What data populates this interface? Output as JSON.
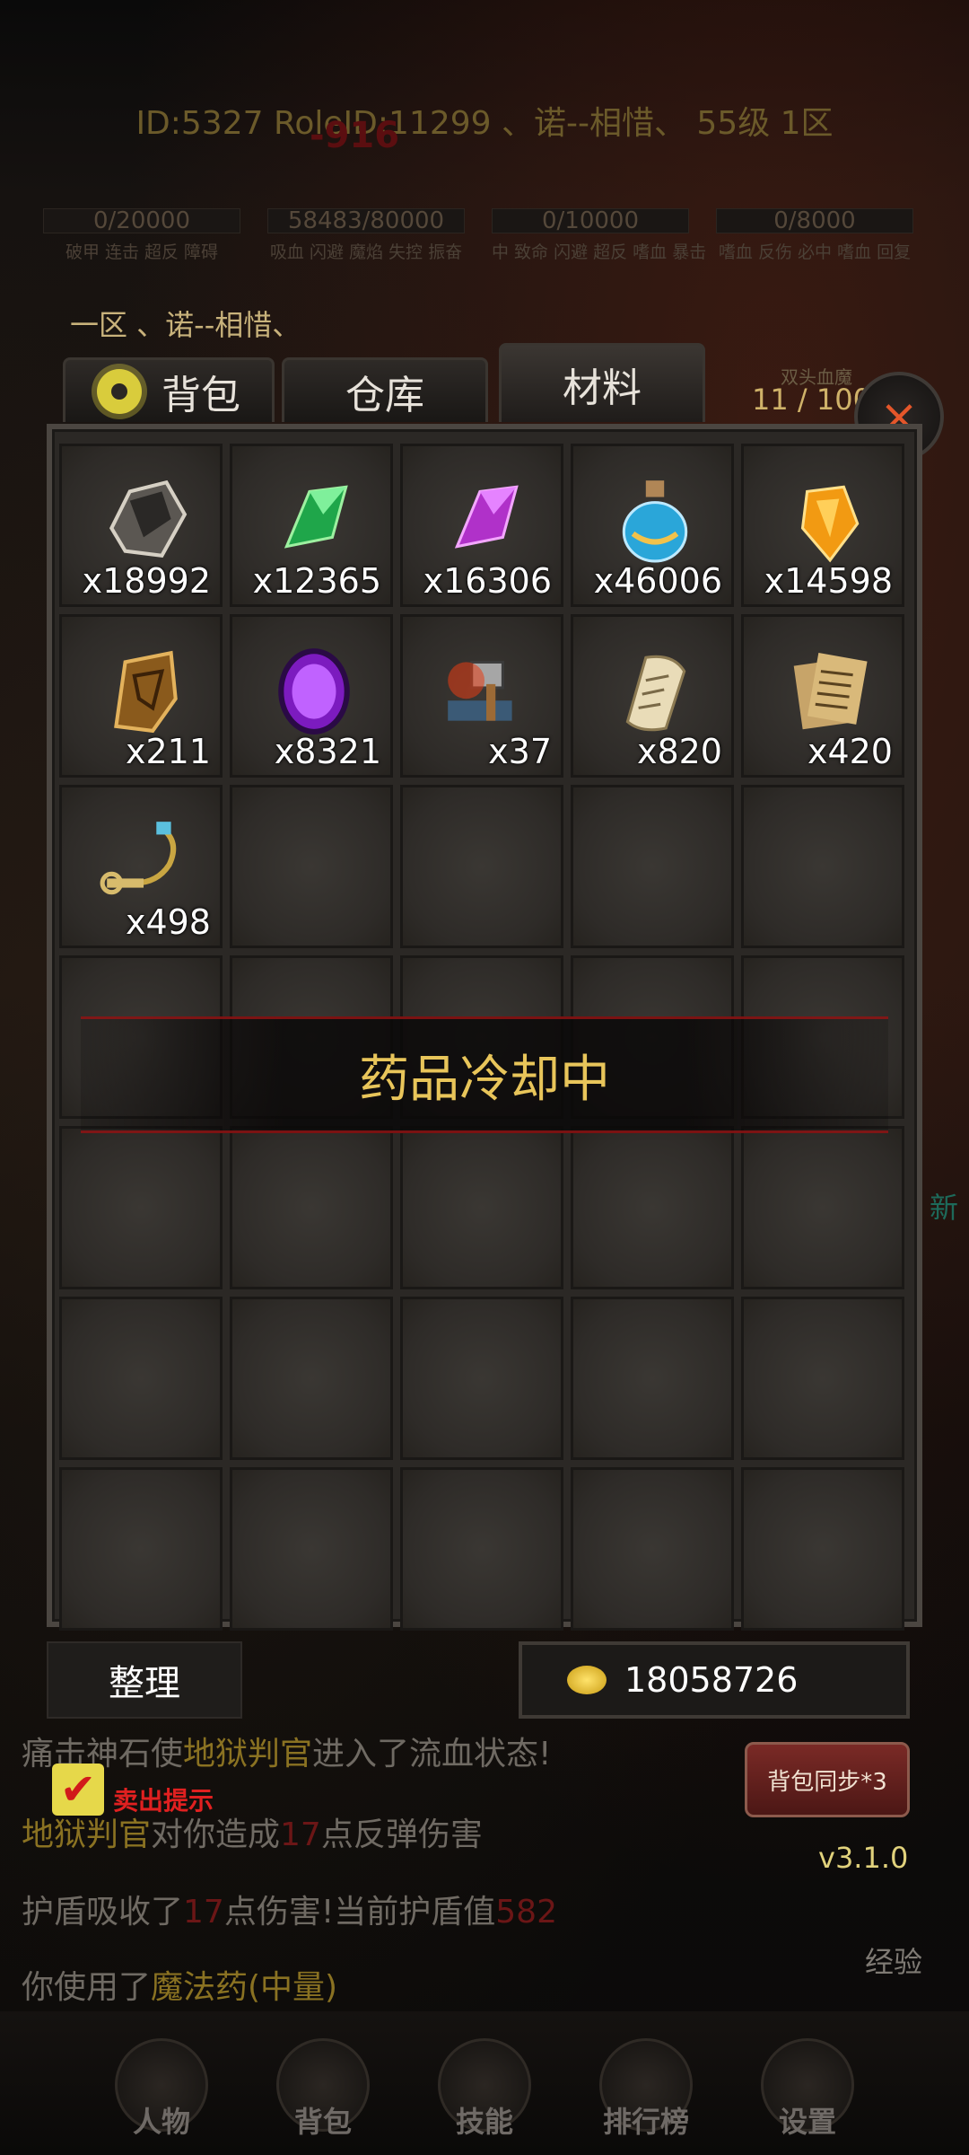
{
  "header": {
    "text": "ID:5327  RoleID:11299  、诺--相惜、  55级  1区",
    "damage": "-916"
  },
  "stats": [
    {
      "value": "0/20000",
      "labels": "破甲 连击 超反 障碍"
    },
    {
      "value": "58483/80000",
      "labels": "吸血 闪避 魔焰 失控 振奋"
    },
    {
      "value": "0/10000",
      "labels": "中 致命 闪避 超反 嗜血 暴击"
    },
    {
      "value": "0/8000",
      "labels": "嗜血 反伤 必中 嗜血 回复"
    }
  ],
  "player_name": "一区 、诺--相惜、",
  "tabs": {
    "bag": "背包",
    "warehouse": "仓库",
    "materials": "材料"
  },
  "capacity_label": "双头血魔",
  "capacity": "11 / 100",
  "close_symbol": "×",
  "items": [
    {
      "icon": "ore-stone-icon",
      "qty": "x18992"
    },
    {
      "icon": "green-crystal-icon",
      "qty": "x12365"
    },
    {
      "icon": "purple-crystal-icon",
      "qty": "x16306"
    },
    {
      "icon": "blue-potion-icon",
      "qty": "x46006"
    },
    {
      "icon": "orange-gem-icon",
      "qty": "x14598"
    },
    {
      "icon": "rune-fragment-icon",
      "qty": "x211"
    },
    {
      "icon": "purple-gem-icon",
      "qty": "x8321"
    },
    {
      "icon": "forge-hammer-icon",
      "qty": "x37"
    },
    {
      "icon": "scroll-icon",
      "qty": "x820"
    },
    {
      "icon": "paper-notes-icon",
      "qty": "x420"
    },
    {
      "icon": "key-chain-icon",
      "qty": "x498"
    }
  ],
  "cooldown_text": "药品冷却中",
  "sort_label": "整理",
  "gold": "18058726",
  "chat": {
    "line1_a": "痛击神石使",
    "line1_b": "地狱判官",
    "line1_c": "进入了流血状态!",
    "line2_a": "地狱判官",
    "line2_b": "对你造成",
    "line2_c": "17",
    "line2_d": "点反弹伤害",
    "line3_a": "护盾吸收了",
    "line3_b": "17",
    "line3_c": "点伤害!当前护盾值",
    "line3_d": "582",
    "line4_a": "你使用了",
    "line4_b": "魔法药(中量)"
  },
  "sell_check": "✔",
  "sell_label": "卖出提示",
  "sync_label": "背包同步*3",
  "version": "v3.1.0",
  "exp_label": "经验",
  "nav": [
    "人物",
    "背包",
    "技能",
    "排行榜",
    "设置"
  ],
  "side_text": "新",
  "colors": {
    "accent_gold": "#e8c55a",
    "danger": "#e02020",
    "panel_border": "#4b4641"
  }
}
